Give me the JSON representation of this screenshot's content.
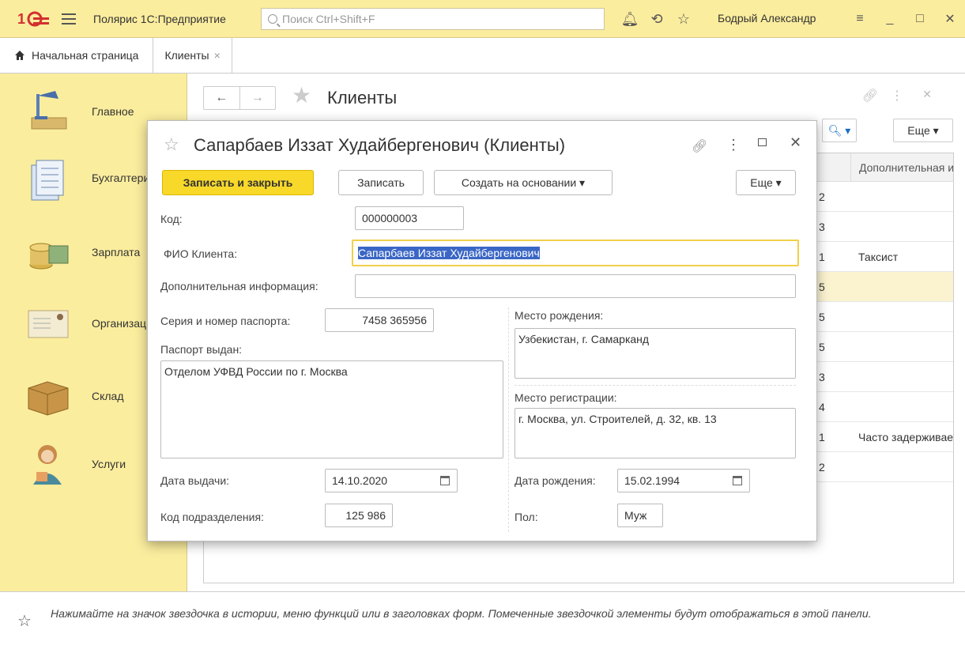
{
  "topbar": {
    "app_title": "Полярис 1С:Предприятие",
    "search_placeholder": "Поиск Ctrl+Shift+F",
    "user": "Бодрый Александр"
  },
  "tabs": {
    "home": "Начальная страница",
    "clients": "Клиенты",
    "close_glyph": "×"
  },
  "sidebar": {
    "items": [
      {
        "label": "Главное"
      },
      {
        "label": "Бухгалтерия"
      },
      {
        "label": "Зарплата"
      },
      {
        "label": "Организация"
      },
      {
        "label": "Склад"
      },
      {
        "label": "Услуги"
      }
    ]
  },
  "list_form": {
    "title": "Клиенты",
    "more_label": "Еще",
    "column_additional": "Дополнительная информация",
    "rows": [
      {
        "c1": "2",
        "c2": ""
      },
      {
        "c1": "3",
        "c2": ""
      },
      {
        "c1": "1",
        "c2": "Таксист"
      },
      {
        "c1": "5",
        "c2": ""
      },
      {
        "c1": "5",
        "c2": ""
      },
      {
        "c1": "5",
        "c2": ""
      },
      {
        "c1": "3",
        "c2": ""
      },
      {
        "c1": "4",
        "c2": ""
      },
      {
        "c1": "1",
        "c2": "Часто задерживает"
      },
      {
        "c1": "2",
        "c2": ""
      }
    ]
  },
  "dialog": {
    "title": "Сапарбаев Иззат Худайбергенович (Клиенты)",
    "buttons": {
      "save_close": "Записать и закрыть",
      "save": "Записать",
      "create_based": "Создать на основании",
      "more": "Еще"
    },
    "fields": {
      "code_label": "Код:",
      "code_value": "000000003",
      "fio_label": "ФИО Клиента:",
      "fio_value": "Сапарбаев Иззат Худайбергенович",
      "additional_label": "Дополнительная информация:",
      "additional_value": "",
      "passport_label": "Серия и номер паспорта:",
      "passport_value": "7458 365956",
      "issued_label": "Паспорт выдан:",
      "issued_value": "Отделом УФВД России по г. Москва",
      "birthplace_label": "Место рождения:",
      "birthplace_value": "Узбекистан, г. Самарканд",
      "registration_label": "Место регистрации:",
      "registration_value": "г. Москва, ул. Строителей, д. 32, кв. 13",
      "issue_date_label": "Дата выдачи:",
      "issue_date_value": "14.10.2020",
      "birth_date_label": "Дата рождения:",
      "birth_date_value": "15.02.1994",
      "division_label": "Код подразделения:",
      "division_value": "125 986",
      "sex_label": "Пол:",
      "sex_value": "Муж"
    }
  },
  "bottom_panel": {
    "hint": "Нажимайте на значок звездочка в истории, меню функций или в заголовках форм. Помеченные звездочкой элементы будут отображаться в этой панели."
  },
  "colors": {
    "accent_yellow": "#fbed9e",
    "primary_button": "#f8d92a",
    "selection": "#3a66c5"
  }
}
